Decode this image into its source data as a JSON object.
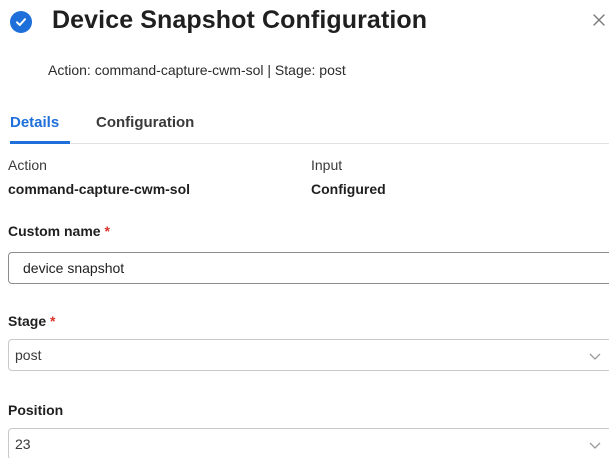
{
  "header": {
    "title": "Device Snapshot Configuration",
    "icon": "check-circle-icon",
    "close_icon": "close-icon",
    "accent_color": "#1e6fd9"
  },
  "subtitle": "Action: command-capture-cwm-sol | Stage: post",
  "tabs": [
    {
      "label": "Details",
      "active": true
    },
    {
      "label": "Configuration",
      "active": false
    }
  ],
  "details": {
    "action_label": "Action",
    "action_value": "command-capture-cwm-sol",
    "input_label": "Input",
    "input_value": "Configured"
  },
  "form": {
    "custom_name": {
      "label": "Custom name",
      "required_mark": "*",
      "value": "device snapshot"
    },
    "stage": {
      "label": "Stage",
      "required_mark": "*",
      "value": "post"
    },
    "position": {
      "label": "Position",
      "value": "23"
    }
  }
}
